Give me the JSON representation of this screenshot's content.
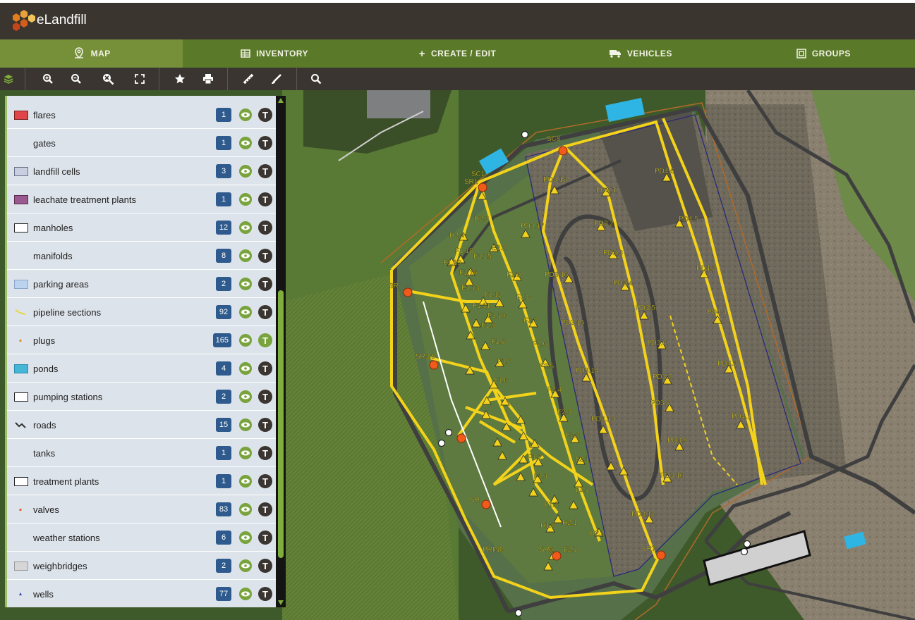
{
  "app": {
    "title": "eLandfill"
  },
  "nav": {
    "tabs": [
      {
        "label": "MAP",
        "icon": "map-pin-icon",
        "active": true
      },
      {
        "label": "INVENTORY",
        "icon": "table-icon",
        "active": false
      },
      {
        "label": "CREATE / EDIT",
        "icon": "plus-icon",
        "active": false
      },
      {
        "label": "VEHICLES",
        "icon": "truck-icon",
        "active": false
      },
      {
        "label": "GROUPS",
        "icon": "groups-icon",
        "active": false
      }
    ]
  },
  "toolbar": {
    "tools": [
      "layers-icon",
      "zoom-in-icon",
      "zoom-out-icon",
      "zoom-reset-icon",
      "fullscreen-icon",
      "favorite-star-icon",
      "print-icon",
      "measure-ruler-icon",
      "draw-icon",
      "search-icon"
    ]
  },
  "layers": [
    {
      "name": "flares",
      "count": "1",
      "swatch": "#e0454a",
      "text_on": false
    },
    {
      "name": "gates",
      "count": "1",
      "swatch": "",
      "text_on": false
    },
    {
      "name": "landfill cells",
      "count": "3",
      "swatch": "#c9cfe0",
      "text_on": false
    },
    {
      "name": "leachate treatment plants",
      "count": "1",
      "swatch": "#9b5a8f",
      "text_on": false
    },
    {
      "name": "manholes",
      "count": "12",
      "swatch": "#ffffff",
      "text_on": false
    },
    {
      "name": "manifolds",
      "count": "8",
      "swatch": "",
      "text_on": false
    },
    {
      "name": "parking areas",
      "count": "2",
      "swatch": "#bcd3f0",
      "text_on": false
    },
    {
      "name": "pipeline sections",
      "count": "92",
      "swatch": "#e8d640",
      "text_on": false
    },
    {
      "name": "plugs",
      "count": "165",
      "swatch": "#e08a2a",
      "text_on": true
    },
    {
      "name": "ponds",
      "count": "4",
      "swatch": "#45b6d8",
      "text_on": false
    },
    {
      "name": "pumping stations",
      "count": "2",
      "swatch": "#ffffff",
      "text_on": false
    },
    {
      "name": "roads",
      "count": "15",
      "swatch": "#333333",
      "text_on": false
    },
    {
      "name": "tanks",
      "count": "1",
      "swatch": "",
      "text_on": false
    },
    {
      "name": "treatment plants",
      "count": "1",
      "swatch": "#ffffff",
      "text_on": false
    },
    {
      "name": "valves",
      "count": "83",
      "swatch": "#e05a2a",
      "text_on": false
    },
    {
      "name": "weather stations",
      "count": "6",
      "swatch": "",
      "text_on": false
    },
    {
      "name": "weighbridges",
      "count": "2",
      "swatch": "#d6d6d6",
      "text_on": false
    },
    {
      "name": "wells",
      "count": "77",
      "swatch": "#2a3ea8",
      "text_on": false
    }
  ],
  "layer_text_toggle": "T",
  "map_labels": [
    "SC8",
    "SC1",
    "SR1",
    "PD3.18",
    "PD3.1",
    "PD4.6",
    "H2.3",
    "PD3.17",
    "PD3.2",
    "PD4.5",
    "H2.4",
    "E2.2",
    "F1.18",
    "F1.15",
    "F1.19",
    "F1.16",
    "PD3.3",
    "PD4.4",
    "F2.9",
    "PD3.16",
    "PD3.4",
    "SR",
    "F1.13",
    "F1.12",
    "F1.11",
    "F2.8",
    "PD3.5",
    "PD4.3",
    "F1.10",
    "F1.9",
    "PD3.15",
    "F2.7",
    "PD3.6",
    "F1.8",
    "F2.6",
    "SR3.9",
    "F1.7",
    "F2.5",
    "PD3.14",
    "PD4.2",
    "F1.6",
    "PD3.7",
    "F2.4",
    "PD3.8",
    "F2.3",
    "PD4.1",
    "PD3.13",
    "F2.2",
    "PD3.9",
    "F2.1",
    "F1.2",
    "PD3.10",
    "F1.1",
    "E2.1",
    "E1.1",
    "PD3.11",
    "H1.0",
    "SR",
    "H2.1",
    "H2.2",
    "SR6",
    "E2.1",
    "SR7",
    "PRING"
  ],
  "map_colors": {
    "pipeline": "#f2d21b",
    "road": "#3f3f3f",
    "pond": "#2fb5e3",
    "boundary": "#b06a2a",
    "valve": "#f05a1a",
    "cell_outline": "#2a2a7a"
  }
}
